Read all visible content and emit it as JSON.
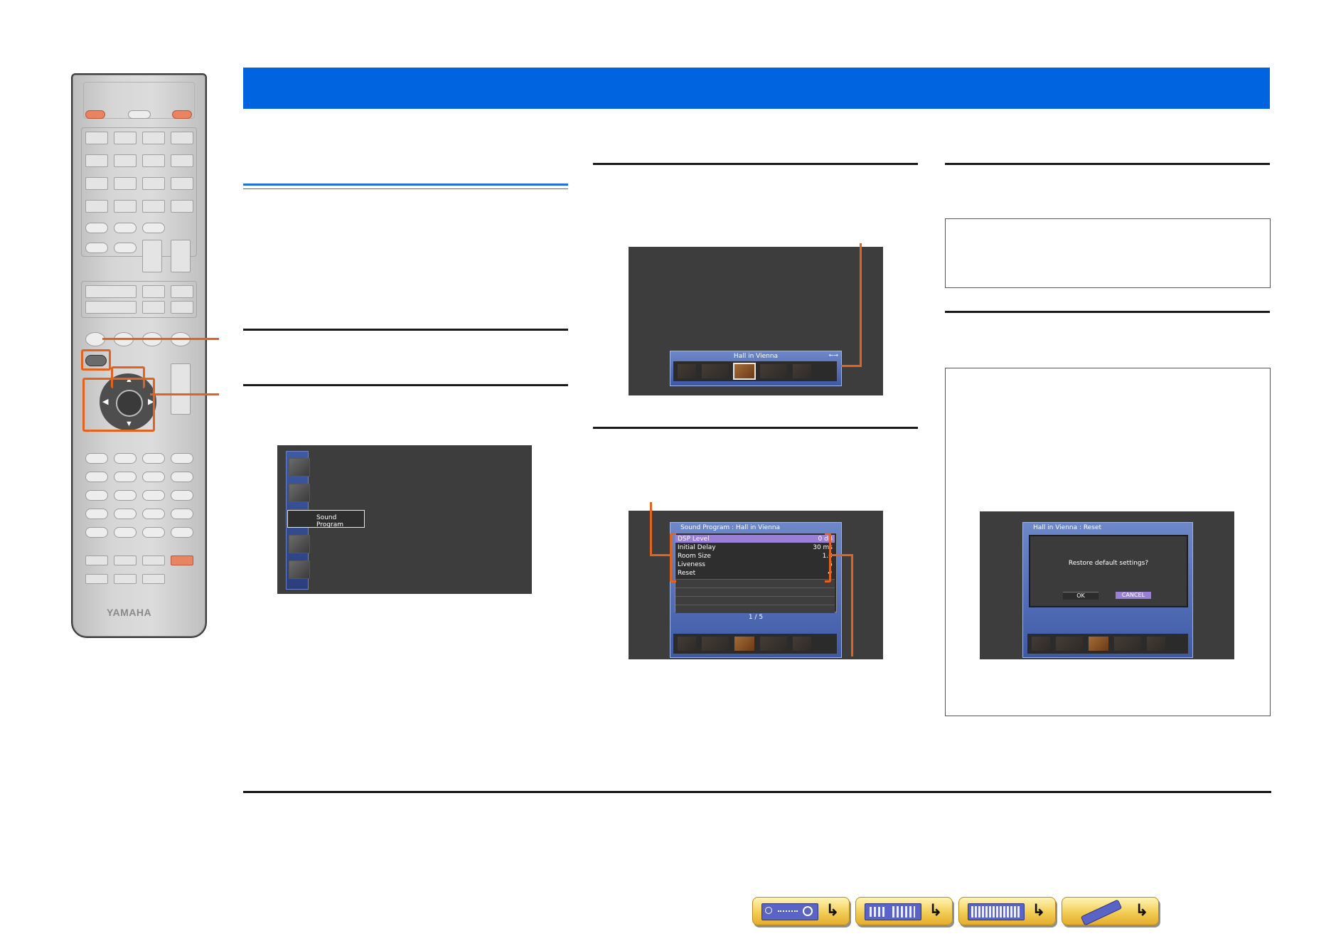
{
  "remote": {
    "brand_logo": "YAMAHA"
  },
  "screen_menu": {
    "selected_item_label": "Sound Program"
  },
  "screen_program": {
    "program_name": "Hall in Vienna"
  },
  "screen_params": {
    "title": "Sound Program : Hall in Vienna",
    "rows": [
      {
        "label": "DSP Level",
        "value": "0 dB"
      },
      {
        "label": "Initial Delay",
        "value": "30 ms"
      },
      {
        "label": "Room Size",
        "value": "1.0"
      },
      {
        "label": "Liveness",
        "value": "5"
      },
      {
        "label": "Reset",
        "value": ""
      }
    ],
    "page_indicator": "1 / 5"
  },
  "screen_reset": {
    "title": "Hall in Vienna : Reset",
    "prompt": "Restore default settings?",
    "ok_label": "OK",
    "cancel_label": "CANCEL"
  },
  "colors": {
    "header_blue": "#0064e1",
    "callout_orange": "#e2621f",
    "selection_purple": "#9a7fd6",
    "nav_button_yellow": "#f2cd55"
  },
  "nav_buttons": [
    {
      "icon": "front-panel-icon"
    },
    {
      "icon": "rear-panel-icon"
    },
    {
      "icon": "display-icon"
    },
    {
      "icon": "remote-icon"
    }
  ]
}
